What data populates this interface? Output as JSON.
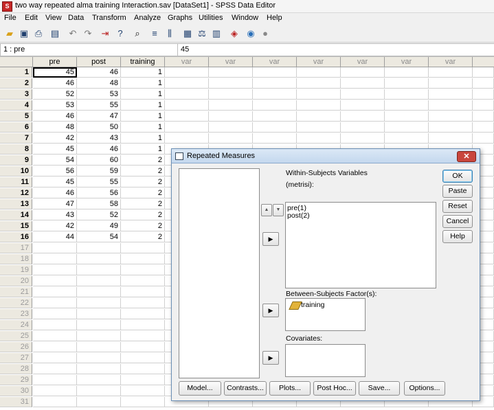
{
  "window": {
    "title": "two way repeated alma training Interaction.sav [DataSet1] - SPSS Data Editor",
    "app_icon_glyph": "S"
  },
  "menu": [
    "File",
    "Edit",
    "View",
    "Data",
    "Transform",
    "Analyze",
    "Graphs",
    "Utilities",
    "Window",
    "Help"
  ],
  "toolbar_icons": [
    "open-folder-icon",
    "save-icon",
    "print-icon",
    "dialog-recall-icon",
    "undo-icon",
    "redo-icon",
    "goto-case-icon",
    "variables-icon",
    "find-icon",
    "insert-cases-icon",
    "insert-variable-icon",
    "split-file-icon",
    "weight-cases-icon",
    "select-cases-icon",
    "value-labels-icon",
    "use-sets-icon",
    "show-all-icon"
  ],
  "cellbar": {
    "ref": "1 : pre",
    "value": "45"
  },
  "grid": {
    "columns": [
      "pre",
      "post",
      "training",
      "var",
      "var",
      "var",
      "var",
      "var",
      "var",
      "var"
    ],
    "rows": [
      [
        "45",
        "46",
        "1"
      ],
      [
        "46",
        "48",
        "1"
      ],
      [
        "52",
        "53",
        "1"
      ],
      [
        "53",
        "55",
        "1"
      ],
      [
        "46",
        "47",
        "1"
      ],
      [
        "48",
        "50",
        "1"
      ],
      [
        "42",
        "43",
        "1"
      ],
      [
        "45",
        "46",
        "1"
      ],
      [
        "54",
        "60",
        "2"
      ],
      [
        "56",
        "59",
        "2"
      ],
      [
        "45",
        "55",
        "2"
      ],
      [
        "46",
        "56",
        "2"
      ],
      [
        "47",
        "58",
        "2"
      ],
      [
        "43",
        "52",
        "2"
      ],
      [
        "42",
        "49",
        "2"
      ],
      [
        "44",
        "54",
        "2"
      ]
    ],
    "row_numbers": [
      "1",
      "2",
      "3",
      "4",
      "5",
      "6",
      "7",
      "8",
      "9",
      "10",
      "11",
      "12",
      "13",
      "14",
      "15",
      "16",
      "17",
      "18",
      "19",
      "20",
      "21",
      "22",
      "23",
      "24",
      "25",
      "26",
      "27",
      "28",
      "29",
      "30",
      "31"
    ]
  },
  "dialog": {
    "title": "Repeated Measures",
    "close_glyph": "✕",
    "within_label": "Within-Subjects Variables",
    "within_factor": "(metrisi):",
    "within_items": [
      "pre(1)",
      "post(2)"
    ],
    "between_label": "Between-Subjects Factor(s):",
    "between_items": [
      "training"
    ],
    "covariates_label": "Covariates:",
    "side_buttons": {
      "ok": "OK",
      "paste": "Paste",
      "reset": "Reset",
      "cancel": "Cancel",
      "help": "Help"
    },
    "bottom_buttons": {
      "model": "Model...",
      "contrasts": "Contrasts...",
      "plots": "Plots...",
      "posthoc": "Post Hoc...",
      "save": "Save...",
      "options": "Options..."
    },
    "arrow_glyph": "▶",
    "up_glyph": "▲",
    "down_glyph": "▼"
  }
}
